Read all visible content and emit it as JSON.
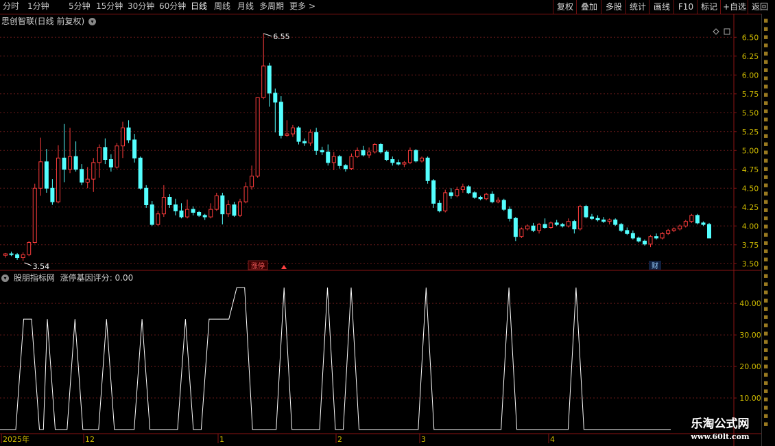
{
  "toolbar": {
    "timeframes": [
      {
        "label": "分时",
        "active": false
      },
      {
        "label": "1分钟",
        "active": false
      },
      {
        "label": "5分钟",
        "active": false
      },
      {
        "label": "15分钟",
        "active": false
      },
      {
        "label": "30分钟",
        "active": false
      },
      {
        "label": "60分钟",
        "active": false
      },
      {
        "label": "日线",
        "active": true
      },
      {
        "label": "周线",
        "active": false
      },
      {
        "label": "月线",
        "active": false
      },
      {
        "label": "多周期",
        "active": false
      },
      {
        "label": "更多",
        "active": false
      }
    ],
    "more_arrow": ">",
    "buttons": [
      "复权",
      "叠加",
      "多股",
      "统计",
      "画线",
      "F10",
      "标记",
      "+自选",
      "返回"
    ]
  },
  "main_panel": {
    "title": "思创智联(日线 前复权)",
    "high_label": "6.55",
    "low_label": "3.54",
    "marker_1": "涨停",
    "marker_2": "财",
    "y_ticks": [
      "6.50",
      "6.25",
      "6.00",
      "5.75",
      "5.50",
      "5.25",
      "5.00",
      "4.75",
      "4.50",
      "4.25",
      "4.00",
      "3.75",
      "3.50"
    ]
  },
  "indicator_panel": {
    "source": "股朋指标网",
    "name": "涨停基因评分",
    "value": "0.00",
    "y_ticks": [
      "40.00",
      "30.00",
      "20.00",
      "10.00"
    ]
  },
  "x_axis": {
    "labels": [
      "2025年",
      "12",
      "1",
      "2",
      "3",
      "4"
    ]
  },
  "watermark": {
    "main": "乐淘公式网",
    "url": "www.60lt.com"
  },
  "colors": {
    "up": "#ff3c3c",
    "down": "#54ffff",
    "border": "#8c1414",
    "grid": "#6a1a1a",
    "indicator": "#ffffff",
    "axis_text": "#d0bc00"
  },
  "chart_data": {
    "type": "candlestick",
    "price_ylim": [
      3.43,
      6.63
    ],
    "indicator_ylim": [
      0,
      47
    ],
    "candles": [
      {
        "o": 3.61,
        "h": 3.64,
        "l": 3.58,
        "c": 3.63
      },
      {
        "o": 3.63,
        "h": 3.66,
        "l": 3.6,
        "c": 3.62
      },
      {
        "o": 3.62,
        "h": 3.64,
        "l": 3.55,
        "c": 3.58
      },
      {
        "o": 3.58,
        "h": 3.65,
        "l": 3.54,
        "c": 3.62
      },
      {
        "o": 3.62,
        "h": 3.8,
        "l": 3.6,
        "c": 3.78
      },
      {
        "o": 3.78,
        "h": 4.56,
        "l": 3.77,
        "c": 4.5
      },
      {
        "o": 4.5,
        "h": 5.17,
        "l": 4.4,
        "c": 4.85
      },
      {
        "o": 4.85,
        "h": 5.02,
        "l": 4.44,
        "c": 4.5
      },
      {
        "o": 4.5,
        "h": 4.62,
        "l": 4.28,
        "c": 4.32
      },
      {
        "o": 4.32,
        "h": 5.07,
        "l": 4.3,
        "c": 4.9
      },
      {
        "o": 4.9,
        "h": 5.35,
        "l": 4.58,
        "c": 4.75
      },
      {
        "o": 4.75,
        "h": 5.3,
        "l": 4.7,
        "c": 4.92
      },
      {
        "o": 4.92,
        "h": 5.12,
        "l": 4.72,
        "c": 4.75
      },
      {
        "o": 4.75,
        "h": 4.82,
        "l": 4.54,
        "c": 4.58
      },
      {
        "o": 4.58,
        "h": 4.78,
        "l": 4.5,
        "c": 4.62
      },
      {
        "o": 4.62,
        "h": 4.9,
        "l": 4.45,
        "c": 4.84
      },
      {
        "o": 4.84,
        "h": 5.08,
        "l": 4.64,
        "c": 5.04
      },
      {
        "o": 5.04,
        "h": 5.16,
        "l": 4.82,
        "c": 4.88
      },
      {
        "o": 4.88,
        "h": 4.95,
        "l": 4.72,
        "c": 4.78
      },
      {
        "o": 4.78,
        "h": 5.1,
        "l": 4.76,
        "c": 5.06
      },
      {
        "o": 5.06,
        "h": 5.38,
        "l": 4.9,
        "c": 5.3
      },
      {
        "o": 5.3,
        "h": 5.4,
        "l": 5.1,
        "c": 5.14
      },
      {
        "o": 5.14,
        "h": 5.22,
        "l": 4.84,
        "c": 4.9
      },
      {
        "o": 4.9,
        "h": 4.92,
        "l": 4.48,
        "c": 4.5
      },
      {
        "o": 4.5,
        "h": 4.54,
        "l": 4.24,
        "c": 4.28
      },
      {
        "o": 4.28,
        "h": 4.33,
        "l": 4.0,
        "c": 4.02
      },
      {
        "o": 4.02,
        "h": 4.2,
        "l": 4.0,
        "c": 4.16
      },
      {
        "o": 4.16,
        "h": 4.54,
        "l": 4.12,
        "c": 4.38
      },
      {
        "o": 4.38,
        "h": 4.42,
        "l": 4.24,
        "c": 4.28
      },
      {
        "o": 4.28,
        "h": 4.36,
        "l": 4.14,
        "c": 4.2
      },
      {
        "o": 4.2,
        "h": 4.3,
        "l": 4.1,
        "c": 4.12
      },
      {
        "o": 4.12,
        "h": 4.35,
        "l": 4.1,
        "c": 4.22
      },
      {
        "o": 4.22,
        "h": 4.26,
        "l": 4.14,
        "c": 4.18
      },
      {
        "o": 4.18,
        "h": 4.2,
        "l": 4.12,
        "c": 4.14
      },
      {
        "o": 4.14,
        "h": 4.16,
        "l": 4.08,
        "c": 4.12
      },
      {
        "o": 4.12,
        "h": 4.3,
        "l": 4.1,
        "c": 4.22
      },
      {
        "o": 4.22,
        "h": 4.44,
        "l": 4.2,
        "c": 4.4
      },
      {
        "o": 4.4,
        "h": 4.44,
        "l": 4.02,
        "c": 4.16
      },
      {
        "o": 4.16,
        "h": 4.34,
        "l": 4.12,
        "c": 4.28
      },
      {
        "o": 4.28,
        "h": 4.32,
        "l": 4.12,
        "c": 4.14
      },
      {
        "o": 4.14,
        "h": 4.36,
        "l": 4.12,
        "c": 4.32
      },
      {
        "o": 4.32,
        "h": 4.58,
        "l": 4.3,
        "c": 4.52
      },
      {
        "o": 4.52,
        "h": 4.8,
        "l": 4.48,
        "c": 4.66
      },
      {
        "o": 4.66,
        "h": 5.7,
        "l": 4.64,
        "c": 5.7
      },
      {
        "o": 5.7,
        "h": 6.55,
        "l": 5.68,
        "c": 6.12
      },
      {
        "o": 6.12,
        "h": 6.16,
        "l": 5.58,
        "c": 5.76
      },
      {
        "o": 5.76,
        "h": 5.82,
        "l": 5.24,
        "c": 5.64
      },
      {
        "o": 5.64,
        "h": 5.72,
        "l": 5.16,
        "c": 5.2
      },
      {
        "o": 5.2,
        "h": 5.4,
        "l": 5.18,
        "c": 5.22
      },
      {
        "o": 5.22,
        "h": 5.34,
        "l": 5.18,
        "c": 5.3
      },
      {
        "o": 5.3,
        "h": 5.32,
        "l": 5.08,
        "c": 5.12
      },
      {
        "o": 5.12,
        "h": 5.16,
        "l": 5.06,
        "c": 5.1
      },
      {
        "o": 5.1,
        "h": 5.28,
        "l": 5.06,
        "c": 5.24
      },
      {
        "o": 5.24,
        "h": 5.3,
        "l": 4.94,
        "c": 5.0
      },
      {
        "o": 5.0,
        "h": 5.05,
        "l": 4.94,
        "c": 4.98
      },
      {
        "o": 4.98,
        "h": 5.08,
        "l": 4.8,
        "c": 4.84
      },
      {
        "o": 4.84,
        "h": 4.98,
        "l": 4.74,
        "c": 4.92
      },
      {
        "o": 4.92,
        "h": 4.94,
        "l": 4.76,
        "c": 4.8
      },
      {
        "o": 4.8,
        "h": 4.82,
        "l": 4.72,
        "c": 4.76
      },
      {
        "o": 4.76,
        "h": 4.96,
        "l": 4.74,
        "c": 4.92
      },
      {
        "o": 4.92,
        "h": 5.04,
        "l": 4.9,
        "c": 5.0
      },
      {
        "o": 5.0,
        "h": 5.06,
        "l": 4.92,
        "c": 4.94
      },
      {
        "o": 4.94,
        "h": 5.04,
        "l": 4.9,
        "c": 4.98
      },
      {
        "o": 4.98,
        "h": 5.1,
        "l": 4.96,
        "c": 5.08
      },
      {
        "o": 5.08,
        "h": 5.1,
        "l": 4.96,
        "c": 4.98
      },
      {
        "o": 4.98,
        "h": 5.0,
        "l": 4.86,
        "c": 4.88
      },
      {
        "o": 4.88,
        "h": 4.92,
        "l": 4.8,
        "c": 4.84
      },
      {
        "o": 4.84,
        "h": 4.88,
        "l": 4.8,
        "c": 4.82
      },
      {
        "o": 4.82,
        "h": 4.86,
        "l": 4.78,
        "c": 4.84
      },
      {
        "o": 4.84,
        "h": 5.04,
        "l": 4.82,
        "c": 5.0
      },
      {
        "o": 5.0,
        "h": 5.02,
        "l": 4.84,
        "c": 4.86
      },
      {
        "o": 4.86,
        "h": 4.92,
        "l": 4.84,
        "c": 4.9
      },
      {
        "o": 4.9,
        "h": 4.92,
        "l": 4.56,
        "c": 4.6
      },
      {
        "o": 4.6,
        "h": 4.62,
        "l": 4.24,
        "c": 4.3
      },
      {
        "o": 4.3,
        "h": 4.34,
        "l": 4.18,
        "c": 4.2
      },
      {
        "o": 4.2,
        "h": 4.48,
        "l": 4.18,
        "c": 4.44
      },
      {
        "o": 4.44,
        "h": 4.5,
        "l": 4.36,
        "c": 4.4
      },
      {
        "o": 4.4,
        "h": 4.52,
        "l": 4.38,
        "c": 4.48
      },
      {
        "o": 4.48,
        "h": 4.56,
        "l": 4.44,
        "c": 4.52
      },
      {
        "o": 4.52,
        "h": 4.54,
        "l": 4.42,
        "c": 4.44
      },
      {
        "o": 4.44,
        "h": 4.46,
        "l": 4.36,
        "c": 4.38
      },
      {
        "o": 4.38,
        "h": 4.4,
        "l": 4.34,
        "c": 4.36
      },
      {
        "o": 4.36,
        "h": 4.44,
        "l": 4.34,
        "c": 4.42
      },
      {
        "o": 4.42,
        "h": 4.46,
        "l": 4.3,
        "c": 4.32
      },
      {
        "o": 4.32,
        "h": 4.38,
        "l": 4.3,
        "c": 4.34
      },
      {
        "o": 4.34,
        "h": 4.36,
        "l": 4.2,
        "c": 4.22
      },
      {
        "o": 4.22,
        "h": 4.26,
        "l": 4.06,
        "c": 4.1
      },
      {
        "o": 4.1,
        "h": 4.12,
        "l": 3.8,
        "c": 3.86
      },
      {
        "o": 3.86,
        "h": 3.98,
        "l": 3.84,
        "c": 3.96
      },
      {
        "o": 3.96,
        "h": 4.02,
        "l": 3.94,
        "c": 4.0
      },
      {
        "o": 4.0,
        "h": 4.04,
        "l": 3.92,
        "c": 3.94
      },
      {
        "o": 3.94,
        "h": 4.04,
        "l": 3.9,
        "c": 4.02
      },
      {
        "o": 4.02,
        "h": 4.1,
        "l": 3.96,
        "c": 3.98
      },
      {
        "o": 3.98,
        "h": 4.06,
        "l": 3.96,
        "c": 4.04
      },
      {
        "o": 4.04,
        "h": 4.08,
        "l": 4.0,
        "c": 4.02
      },
      {
        "o": 4.02,
        "h": 4.04,
        "l": 3.98,
        "c": 4.0
      },
      {
        "o": 4.0,
        "h": 4.1,
        "l": 3.98,
        "c": 4.06
      },
      {
        "o": 4.06,
        "h": 4.08,
        "l": 3.9,
        "c": 3.96
      },
      {
        "o": 3.96,
        "h": 4.28,
        "l": 3.94,
        "c": 4.26
      },
      {
        "o": 4.26,
        "h": 4.28,
        "l": 4.1,
        "c": 4.12
      },
      {
        "o": 4.12,
        "h": 4.16,
        "l": 4.08,
        "c": 4.1
      },
      {
        "o": 4.1,
        "h": 4.14,
        "l": 4.06,
        "c": 4.08
      },
      {
        "o": 4.08,
        "h": 4.12,
        "l": 4.04,
        "c": 4.06
      },
      {
        "o": 4.06,
        "h": 4.1,
        "l": 4.02,
        "c": 4.08
      },
      {
        "o": 4.08,
        "h": 4.1,
        "l": 4.0,
        "c": 4.02
      },
      {
        "o": 4.02,
        "h": 4.04,
        "l": 3.92,
        "c": 3.94
      },
      {
        "o": 3.94,
        "h": 3.98,
        "l": 3.88,
        "c": 3.9
      },
      {
        "o": 3.9,
        "h": 3.94,
        "l": 3.82,
        "c": 3.84
      },
      {
        "o": 3.84,
        "h": 3.86,
        "l": 3.78,
        "c": 3.8
      },
      {
        "o": 3.8,
        "h": 3.82,
        "l": 3.74,
        "c": 3.76
      },
      {
        "o": 3.76,
        "h": 3.88,
        "l": 3.72,
        "c": 3.86
      },
      {
        "o": 3.86,
        "h": 3.9,
        "l": 3.82,
        "c": 3.84
      },
      {
        "o": 3.84,
        "h": 3.92,
        "l": 3.82,
        "c": 3.9
      },
      {
        "o": 3.9,
        "h": 3.96,
        "l": 3.88,
        "c": 3.94
      },
      {
        "o": 3.94,
        "h": 3.98,
        "l": 3.92,
        "c": 3.96
      },
      {
        "o": 3.96,
        "h": 4.02,
        "l": 3.94,
        "c": 4.0
      },
      {
        "o": 4.0,
        "h": 4.08,
        "l": 3.98,
        "c": 4.06
      },
      {
        "o": 4.06,
        "h": 4.16,
        "l": 4.04,
        "c": 4.14
      },
      {
        "o": 4.14,
        "h": 4.16,
        "l": 4.02,
        "c": 4.04
      },
      {
        "o": 4.04,
        "h": 4.06,
        "l": 4.0,
        "c": 4.02
      },
      {
        "o": 4.02,
        "h": 4.04,
        "l": 3.84,
        "c": 3.84
      }
    ],
    "indicator_points": [
      [
        0,
        0
      ],
      [
        4,
        0
      ],
      [
        6,
        35
      ],
      [
        8,
        35
      ],
      [
        10,
        0
      ],
      [
        11,
        0
      ],
      [
        12,
        35
      ],
      [
        14,
        0
      ],
      [
        17,
        0
      ],
      [
        19,
        35
      ],
      [
        21,
        0
      ],
      [
        25,
        0
      ],
      [
        27,
        35
      ],
      [
        29,
        0
      ],
      [
        34,
        0
      ],
      [
        36,
        35
      ],
      [
        38,
        0
      ],
      [
        45,
        0
      ],
      [
        47,
        35
      ],
      [
        49,
        0
      ],
      [
        51,
        0
      ],
      [
        53,
        35
      ],
      [
        55,
        35
      ],
      [
        58,
        35
      ],
      [
        60,
        45
      ],
      [
        62,
        45
      ],
      [
        64,
        0
      ],
      [
        70,
        0
      ],
      [
        72,
        45
      ],
      [
        74,
        0
      ],
      [
        81,
        0
      ],
      [
        83,
        45
      ],
      [
        85,
        0
      ],
      [
        87,
        0
      ],
      [
        89,
        45
      ],
      [
        91,
        0
      ],
      [
        106,
        0
      ],
      [
        108,
        45
      ],
      [
        110,
        0
      ],
      [
        127,
        0
      ],
      [
        129,
        45
      ],
      [
        131,
        0
      ],
      [
        144,
        0
      ],
      [
        146,
        45
      ],
      [
        148,
        0
      ],
      [
        170,
        0
      ]
    ]
  }
}
